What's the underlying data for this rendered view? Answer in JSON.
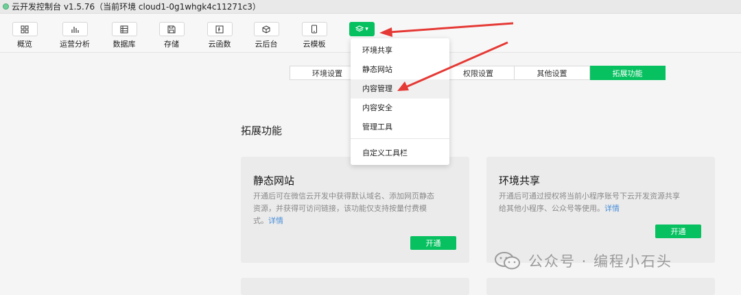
{
  "window": {
    "title": "云开发控制台 v1.5.76（当前环境 cloud1-0g1whgk4c11271c3）"
  },
  "toolbar": {
    "items": [
      {
        "label": "概览",
        "icon": "grid-icon"
      },
      {
        "label": "运营分析",
        "icon": "bar-chart-icon"
      },
      {
        "label": "数据库",
        "icon": "database-icon"
      },
      {
        "label": "存储",
        "icon": "save-icon"
      },
      {
        "label": "云函数",
        "icon": "function-icon"
      },
      {
        "label": "云后台",
        "icon": "cube-icon"
      },
      {
        "label": "云模板",
        "icon": "phone-template-icon"
      }
    ],
    "more_icon": "layers-icon"
  },
  "tabs": [
    "环境设置",
    "权限设置",
    "其他设置",
    "拓展功能"
  ],
  "active_tab": "拓展功能",
  "section_title": "拓展功能",
  "cards": [
    {
      "title": "静态网站",
      "desc_lines": [
        "开通后可在微信云开发中获得默认域名、添加网页静态",
        "资源，并获得可访问链接，该功能仅支持按量付费模",
        "式。"
      ],
      "link": "详情",
      "button": "开通"
    },
    {
      "title": "环境共享",
      "desc_lines": [
        "开通后可通过授权将当前小程序账号下云开发资源共享",
        "给其他小程序、公众号等使用。"
      ],
      "link": "详情",
      "button": "开通"
    }
  ],
  "menu": {
    "items": [
      "环境共享",
      "静态网站",
      "内容管理",
      "内容安全",
      "管理工具"
    ],
    "footer_item": "自定义工具栏",
    "highlighted": "内容管理"
  },
  "watermark": {
    "text": "公众号 · 编程小石头"
  },
  "colors": {
    "accent": "#07c160",
    "arrow": "#e53935",
    "link": "#4a8fd8"
  }
}
